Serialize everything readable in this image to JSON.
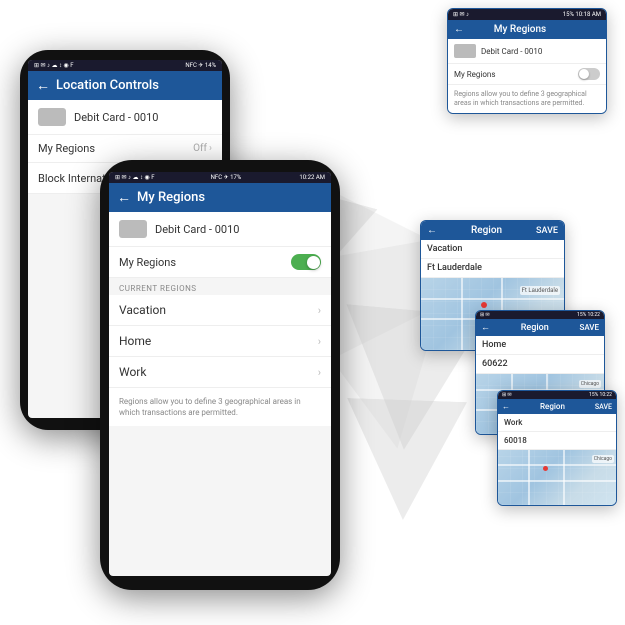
{
  "decorative": {
    "arrow_label": "decorative background arrow"
  },
  "phone_back": {
    "status_bar": {
      "icons_left": "⊞ ✉ ♪ ☁ ↕ ◉ F",
      "icons_right": "NFC ✈ 14%",
      "time": ""
    },
    "app_bar": {
      "back": "←",
      "title": "Location Controls"
    },
    "card_label": "Debit Card - 0010",
    "my_regions_label": "My Regions",
    "my_regions_value": "Off",
    "block_international_label": "Block International",
    "toggle_state": "on"
  },
  "phone_front": {
    "status_bar": {
      "icons_left": "⊞ ✉ ♪ ☁ ↕ ◉ F",
      "icons_right": "NFC ✈ 17%",
      "time": "10:22 AM"
    },
    "app_bar": {
      "back": "←",
      "title": "My Regions"
    },
    "card_label": "Debit Card - 0010",
    "my_regions_label": "My Regions",
    "toggle_state": "on",
    "section_label": "CURRENT REGIONS",
    "regions": [
      {
        "name": "Vacation"
      },
      {
        "name": "Home"
      },
      {
        "name": "Work"
      }
    ],
    "description": "Regions allow you to define 3 geographical areas in which transactions are permitted."
  },
  "popup_top": {
    "status_bar": {
      "icons_left": "⊞ ✉ ♪",
      "icons_right": "15% 10:18 AM"
    },
    "app_bar": {
      "back": "←",
      "title": "My Regions"
    },
    "card_label": "Debit Card - 0010",
    "my_regions_label": "My Regions",
    "description": "Regions allow you to define 3 geographical areas in which transactions are permitted."
  },
  "popup_vacation": {
    "app_bar": {
      "back": "←",
      "title": "Region",
      "save": "SAVE"
    },
    "region_name": "Vacation",
    "location": "Ft Lauderdale",
    "map_height": 72
  },
  "popup_home": {
    "app_bar": {
      "back": "←",
      "title": "Region",
      "save": "SAVE"
    },
    "region_name": "Home",
    "location": "60622",
    "map_height": 60
  },
  "popup_work": {
    "app_bar": {
      "back": "←",
      "title": "Region",
      "save": "SAVE"
    },
    "region_name": "Work",
    "location": "60018",
    "map_height": 55
  }
}
